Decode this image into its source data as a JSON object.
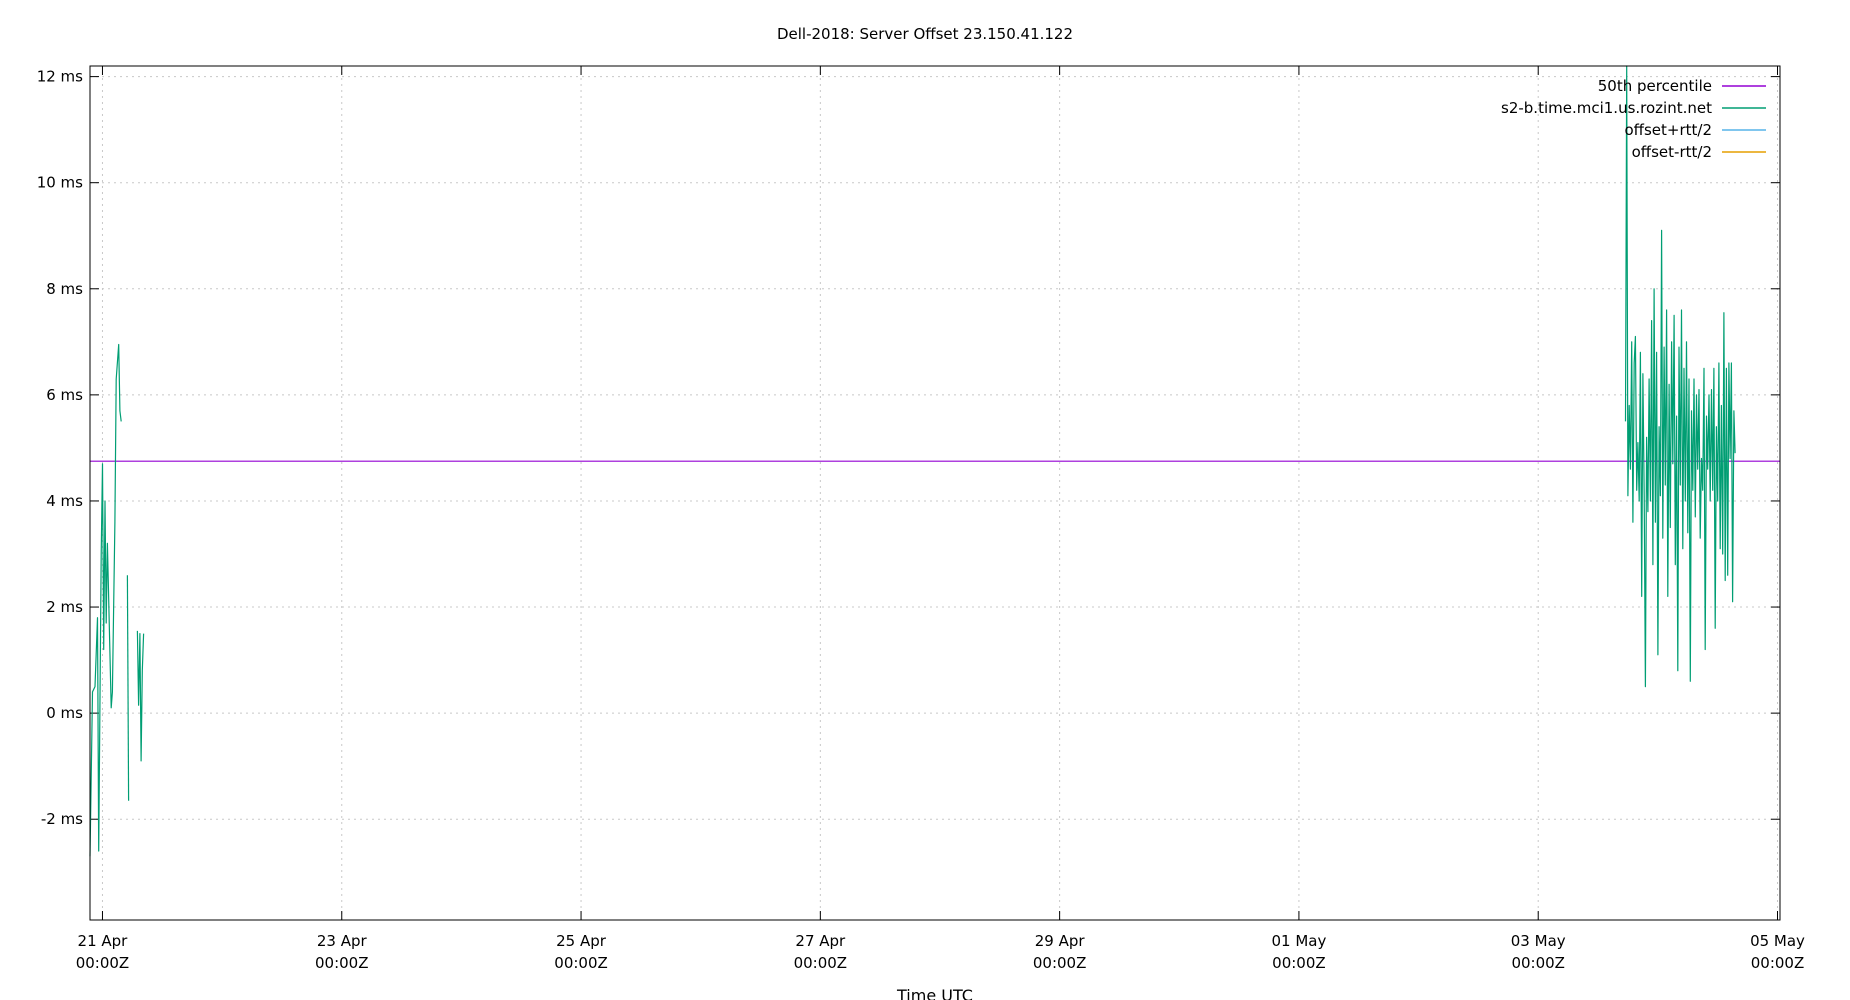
{
  "chart_data": {
    "type": "line",
    "title": "Dell-2018: Server Offset 23.150.41.122",
    "xlabel": "Time UTC",
    "ylabel": "",
    "ylim": [
      -3.9,
      12.2
    ],
    "yticks": [
      {
        "value": 12,
        "label": "12 ms"
      },
      {
        "value": 10,
        "label": "10 ms"
      },
      {
        "value": 8,
        "label": "8 ms"
      },
      {
        "value": 6,
        "label": "6 ms"
      },
      {
        "value": 4,
        "label": "4 ms"
      },
      {
        "value": 2,
        "label": "2 ms"
      },
      {
        "value": 0,
        "label": "0 ms"
      },
      {
        "value": -2,
        "label": "-2 ms"
      }
    ],
    "xlim": [
      "2018-04-20T21:30Z",
      "2018-05-05T00:30Z"
    ],
    "xticks": [
      {
        "value": "2018-04-21T00:00Z",
        "date": "21 Apr",
        "time": "00:00Z"
      },
      {
        "value": "2018-04-23T00:00Z",
        "date": "23 Apr",
        "time": "00:00Z"
      },
      {
        "value": "2018-04-25T00:00Z",
        "date": "25 Apr",
        "time": "00:00Z"
      },
      {
        "value": "2018-04-27T00:00Z",
        "date": "27 Apr",
        "time": "00:00Z"
      },
      {
        "value": "2018-04-29T00:00Z",
        "date": "29 Apr",
        "time": "00:00Z"
      },
      {
        "value": "2018-05-01T00:00Z",
        "date": "01 May",
        "time": "00:00Z"
      },
      {
        "value": "2018-05-03T00:00Z",
        "date": "03 May",
        "time": "00:00Z"
      },
      {
        "value": "2018-05-05T00:00Z",
        "date": "05 May",
        "time": "00:00Z"
      }
    ],
    "grid": true,
    "legend_position": "top-right",
    "series": [
      {
        "name": "50th percentile",
        "color": "#9400d3",
        "kind": "hline",
        "y": 4.75
      },
      {
        "name": "s2-b.time.mci1.us.rozint.net",
        "color": "#009e73",
        "kind": "line",
        "segments": [
          [
            [
              "2018-04-20T21:30Z",
              -2.7
            ],
            [
              "2018-04-20T22:00Z",
              0.4
            ],
            [
              "2018-04-20T22:30Z",
              0.5
            ],
            [
              "2018-04-20T23:00Z",
              1.8
            ],
            [
              "2018-04-20T23:15Z",
              -2.6
            ],
            [
              "2018-04-20T23:45Z",
              3.0
            ],
            [
              "2018-04-21T00:00Z",
              4.7
            ],
            [
              "2018-04-21T00:15Z",
              1.2
            ],
            [
              "2018-04-21T00:30Z",
              4.0
            ],
            [
              "2018-04-21T00:45Z",
              1.7
            ],
            [
              "2018-04-21T01:00Z",
              3.2
            ],
            [
              "2018-04-21T01:45Z",
              0.1
            ],
            [
              "2018-04-21T02:00Z",
              0.4
            ],
            [
              "2018-04-21T02:30Z",
              3.6
            ],
            [
              "2018-04-21T02:45Z",
              6.3
            ],
            [
              "2018-04-21T03:15Z",
              6.95
            ],
            [
              "2018-04-21T03:30Z",
              5.7
            ],
            [
              "2018-04-21T03:45Z",
              5.5
            ]
          ],
          [
            [
              "2018-04-21T05:00Z",
              2.6
            ],
            [
              "2018-04-21T05:15Z",
              -1.65
            ]
          ],
          [
            [
              "2018-04-21T07:00Z",
              1.55
            ],
            [
              "2018-04-21T07:15Z",
              0.15
            ],
            [
              "2018-04-21T07:30Z",
              1.5
            ],
            [
              "2018-04-21T07:45Z",
              -0.9
            ],
            [
              "2018-04-21T08:00Z",
              0.8
            ],
            [
              "2018-04-21T08:15Z",
              1.5
            ]
          ],
          [
            [
              "2018-05-03T17:30Z",
              5.5
            ],
            [
              "2018-05-03T17:45Z",
              12.2
            ],
            [
              "2018-05-03T18:00Z",
              4.1
            ],
            [
              "2018-05-03T18:15Z",
              5.8
            ],
            [
              "2018-05-03T18:30Z",
              4.6
            ],
            [
              "2018-05-03T18:45Z",
              7.0
            ],
            [
              "2018-05-03T19:00Z",
              3.6
            ],
            [
              "2018-05-03T19:15Z",
              6.6
            ],
            [
              "2018-05-03T19:30Z",
              7.1
            ],
            [
              "2018-05-03T19:45Z",
              4.2
            ],
            [
              "2018-05-03T20:00Z",
              5.1
            ],
            [
              "2018-05-03T20:15Z",
              4.0
            ],
            [
              "2018-05-03T20:30Z",
              6.8
            ],
            [
              "2018-05-03T20:45Z",
              2.2
            ],
            [
              "2018-05-03T21:00Z",
              6.4
            ],
            [
              "2018-05-03T21:15Z",
              4.1
            ],
            [
              "2018-05-03T21:30Z",
              0.5
            ],
            [
              "2018-05-03T21:45Z",
              5.2
            ],
            [
              "2018-05-03T22:00Z",
              3.8
            ],
            [
              "2018-05-03T22:15Z",
              6.3
            ],
            [
              "2018-05-03T22:30Z",
              4.0
            ],
            [
              "2018-05-03T22:45Z",
              7.4
            ],
            [
              "2018-05-03T23:00Z",
              2.8
            ],
            [
              "2018-05-03T23:15Z",
              8.0
            ],
            [
              "2018-05-03T23:30Z",
              3.6
            ],
            [
              "2018-05-03T23:45Z",
              6.8
            ],
            [
              "2018-05-04T00:00Z",
              1.1
            ],
            [
              "2018-05-04T00:15Z",
              5.4
            ],
            [
              "2018-05-04T00:30Z",
              4.1
            ],
            [
              "2018-05-04T00:45Z",
              9.1
            ],
            [
              "2018-05-04T01:00Z",
              3.3
            ],
            [
              "2018-05-04T01:15Z",
              6.9
            ],
            [
              "2018-05-04T01:30Z",
              4.3
            ],
            [
              "2018-05-04T01:45Z",
              7.6
            ],
            [
              "2018-05-04T02:00Z",
              2.2
            ],
            [
              "2018-05-04T02:15Z",
              6.2
            ],
            [
              "2018-05-04T02:30Z",
              3.5
            ],
            [
              "2018-05-04T02:45Z",
              7.0
            ],
            [
              "2018-05-04T03:00Z",
              4.7
            ],
            [
              "2018-05-04T03:15Z",
              7.5
            ],
            [
              "2018-05-04T03:30Z",
              2.8
            ],
            [
              "2018-05-04T03:45Z",
              5.6
            ],
            [
              "2018-05-04T04:00Z",
              0.8
            ],
            [
              "2018-05-04T04:15Z",
              6.9
            ],
            [
              "2018-05-04T04:30Z",
              4.3
            ],
            [
              "2018-05-04T04:45Z",
              7.6
            ],
            [
              "2018-05-04T05:00Z",
              3.1
            ],
            [
              "2018-05-04T05:15Z",
              6.5
            ],
            [
              "2018-05-04T05:30Z",
              4.0
            ],
            [
              "2018-05-04T05:45Z",
              7.0
            ],
            [
              "2018-05-04T06:00Z",
              3.4
            ],
            [
              "2018-05-04T06:15Z",
              6.3
            ],
            [
              "2018-05-04T06:30Z",
              0.6
            ],
            [
              "2018-05-04T06:45Z",
              5.7
            ],
            [
              "2018-05-04T07:00Z",
              4.2
            ],
            [
              "2018-05-04T07:15Z",
              6.3
            ],
            [
              "2018-05-04T07:30Z",
              3.7
            ],
            [
              "2018-05-04T07:45Z",
              6.0
            ],
            [
              "2018-05-04T08:00Z",
              4.6
            ],
            [
              "2018-05-04T08:15Z",
              6.1
            ],
            [
              "2018-05-04T08:30Z",
              3.3
            ],
            [
              "2018-05-04T08:45Z",
              4.8
            ],
            [
              "2018-05-04T09:00Z",
              4.2
            ],
            [
              "2018-05-04T09:15Z",
              6.5
            ],
            [
              "2018-05-04T09:30Z",
              1.2
            ],
            [
              "2018-05-04T09:45Z",
              5.6
            ],
            [
              "2018-05-04T10:00Z",
              4.6
            ],
            [
              "2018-05-04T10:15Z",
              6.0
            ],
            [
              "2018-05-04T10:30Z",
              4.0
            ],
            [
              "2018-05-04T10:45Z",
              6.1
            ],
            [
              "2018-05-04T11:00Z",
              4.2
            ],
            [
              "2018-05-04T11:15Z",
              6.5
            ],
            [
              "2018-05-04T11:30Z",
              1.6
            ],
            [
              "2018-05-04T11:45Z",
              5.4
            ],
            [
              "2018-05-04T12:00Z",
              4.0
            ],
            [
              "2018-05-04T12:15Z",
              6.6
            ],
            [
              "2018-05-04T12:30Z",
              3.1
            ],
            [
              "2018-05-04T12:45Z",
              5.8
            ],
            [
              "2018-05-04T13:00Z",
              3.0
            ],
            [
              "2018-05-04T13:15Z",
              7.55
            ],
            [
              "2018-05-04T13:30Z",
              2.5
            ],
            [
              "2018-05-04T13:45Z",
              6.5
            ],
            [
              "2018-05-04T14:00Z",
              2.6
            ],
            [
              "2018-05-04T14:15Z",
              6.6
            ],
            [
              "2018-05-04T14:30Z",
              4.8
            ],
            [
              "2018-05-04T14:45Z",
              6.6
            ],
            [
              "2018-05-04T15:00Z",
              2.1
            ],
            [
              "2018-05-04T15:15Z",
              5.7
            ],
            [
              "2018-05-04T15:30Z",
              4.9
            ]
          ]
        ]
      },
      {
        "name": "offset+rtt/2",
        "color": "#56b4e9",
        "kind": "line",
        "segments": []
      },
      {
        "name": "offset-rtt/2",
        "color": "#e69f00",
        "kind": "line",
        "segments": []
      }
    ]
  }
}
